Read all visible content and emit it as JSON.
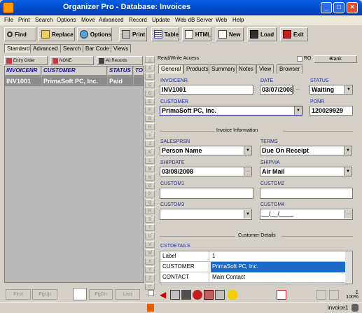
{
  "window": {
    "title": "Organizer Pro - Database: Invoices"
  },
  "menu": [
    "File",
    "Print",
    "Search",
    "Options",
    "Move",
    "Advanced",
    "Record",
    "Update",
    "Web dB Server",
    "Web",
    "Help"
  ],
  "toolbar": {
    "find": "Find",
    "replace": "Replace",
    "options": "Options",
    "print": "Print",
    "table": "Table",
    "html": "HTML",
    "new": "New",
    "load": "Load",
    "exit": "Exit"
  },
  "left_tabs": [
    "Standard",
    "Advanced",
    "Search",
    "Bar Code",
    "Views"
  ],
  "filter": {
    "entry_order": "Entry Order",
    "none": "NONE",
    "all_records": "All Records"
  },
  "grid": {
    "columns": [
      "INVOICENR",
      "CUSTOMER",
      "STATUS",
      "TO"
    ],
    "rows": [
      [
        "INV1001",
        "PrimaSoft PC, Inc.",
        "Paid",
        ""
      ]
    ]
  },
  "nav": {
    "first": "First",
    "pgup": "PgUp",
    "pgdn": "PgDn",
    "last": "Last"
  },
  "alphabet": [
    "A",
    "B",
    "C",
    "D",
    "E",
    "F",
    "G",
    "H",
    "I",
    "J",
    "K",
    "L",
    "M",
    "N",
    "O",
    "P",
    "Q",
    "R",
    "S",
    "T",
    "U",
    "V",
    "W",
    "X",
    "Y",
    "Z"
  ],
  "mode": {
    "label": "Read/Write Access",
    "ro": "RO",
    "blank": "Blank"
  },
  "form_tabs": [
    "General",
    "Products",
    "Summary",
    "Notes",
    "View",
    "Browser"
  ],
  "form": {
    "invoicenr_label": "INVOICENR",
    "invoicenr": "INV1001",
    "date_label": "DATE",
    "date": "03/07/2008",
    "status_label": "STATUS",
    "status": "Waiting",
    "customer_label": "CUSTOMER",
    "customer": "PrimaSoft PC, Inc.",
    "ponr_label": "PONR",
    "ponr": "120029929",
    "section_invoice": "Invoice Information",
    "salesprsn_label": "SALESPRSN",
    "salesprsn": "Person Name",
    "terms_label": "TERMS",
    "terms": "Due On Receipt",
    "shipdate_label": "SHIPDATE",
    "shipdate": "03/08/2008",
    "shipvia_label": "SHIPVIA",
    "shipvia": "Air Mail",
    "custom1_label": "CUSTOM1",
    "custom1": "",
    "custom2_label": "CUSTOM2",
    "custom2": "",
    "custom3_label": "CUSTOM3",
    "custom3": "",
    "custom4_label": "CUSTOM4",
    "custom4": "__/__/____",
    "section_customer": "Customer Details",
    "cstdetails_label": "CSTDETAILS",
    "details": [
      [
        "Label",
        "1"
      ],
      [
        "CUSTOMER",
        "PrimaSoft PC, Inc."
      ],
      [
        "CONTACT",
        "Main Contact"
      ]
    ]
  },
  "record_counter": {
    "count": "1",
    "zoom": "100%"
  },
  "status": {
    "db": "invoice1"
  }
}
